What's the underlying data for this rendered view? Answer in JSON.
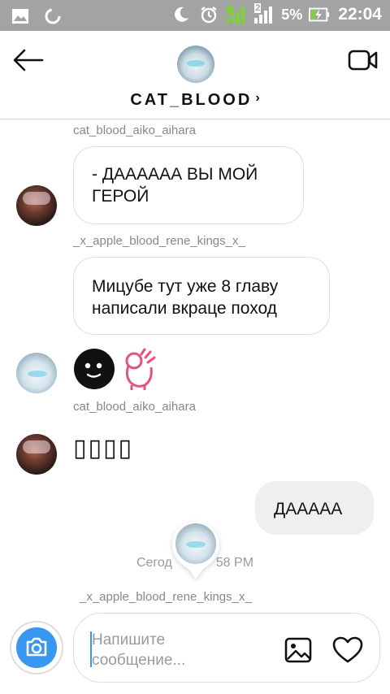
{
  "status_bar": {
    "sim_label": "2",
    "battery_percent": "5%",
    "time": "22:04"
  },
  "header": {
    "title": "CAT_BLOOD",
    "title_chevron": "›",
    "back_icon": "back-arrow-icon",
    "video_icon": "video-call-icon"
  },
  "messages": [
    {
      "sender": "cat_blood_aiko_aihara",
      "text": "- ДАААААА ВЫ МОЙ ГЕРОЙ"
    },
    {
      "sender": "_x_apple_blood_rene_kings_x_",
      "text": "Мицубе тут уже 8 главу написали вкраце поход"
    },
    {
      "emojis": [
        "dark-face-emoji",
        "ok-hand-emoji"
      ]
    },
    {
      "sender": "cat_blood_aiko_aihara",
      "text": "▯▯▯▯"
    },
    {
      "mine": true,
      "text": "ДААААА"
    }
  ],
  "timestamp": "Сегодня 9:58 PM",
  "timestamp_visible_left": "Сегод",
  "timestamp_visible_right": "58 PM",
  "bottom_partial_sender": "_x_apple_blood_rene_kings_x_",
  "composer": {
    "placeholder_line1": "Напишите",
    "placeholder_line2": "сообщение...",
    "camera_icon": "camera-icon",
    "gallery_icon": "gallery-icon",
    "heart_icon": "heart-icon"
  },
  "colors": {
    "status_bar": "#a3a3a3",
    "accent_blue": "#3897f0",
    "signal_green": "#7fd13b",
    "bubble_border": "#dedede",
    "my_bubble_bg": "#efefef"
  }
}
